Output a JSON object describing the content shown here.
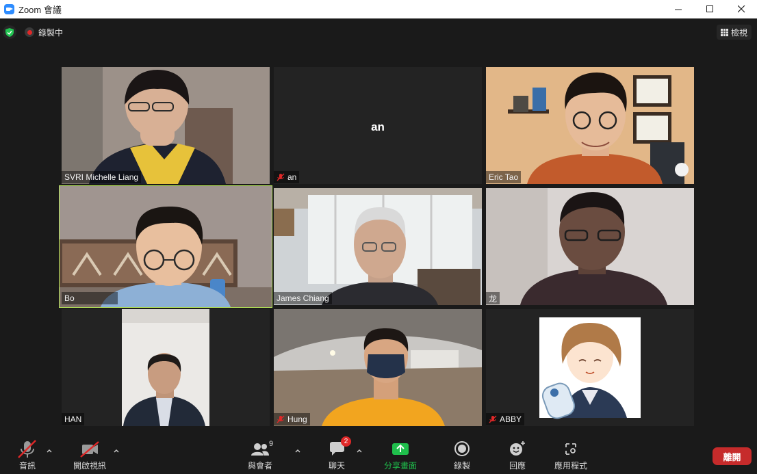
{
  "window": {
    "title": "Zoom 會議"
  },
  "topbar": {
    "recording_label": "錄製中",
    "view_label": "檢視"
  },
  "participants": [
    {
      "name": "SVRI Michelle Liang",
      "muted": false
    },
    {
      "name": "an",
      "muted": true,
      "video_off_label": "an"
    },
    {
      "name": "Eric Tao",
      "muted": false
    },
    {
      "name": "Bo",
      "muted": false,
      "active_speaker": true
    },
    {
      "name": "James Chiang",
      "muted": false
    },
    {
      "name": "龙",
      "muted": false
    },
    {
      "name": "HAN",
      "muted": false
    },
    {
      "name": "Hung",
      "muted": true
    },
    {
      "name": "ABBY",
      "muted": true
    }
  ],
  "toolbar": {
    "audio_label": "音訊",
    "video_label": "開啟視訊",
    "participants_label": "與會者",
    "participants_count": "9",
    "chat_label": "聊天",
    "chat_badge": "2",
    "share_label": "分享畫面",
    "record_label": "錄製",
    "reactions_label": "回應",
    "apps_label": "應用程式",
    "leave_label": "離開"
  },
  "colors": {
    "active_speaker": "#b5e55a",
    "share_green": "#1fbf4c",
    "leave_red": "#c62b2b",
    "mute_red": "#e02828"
  }
}
